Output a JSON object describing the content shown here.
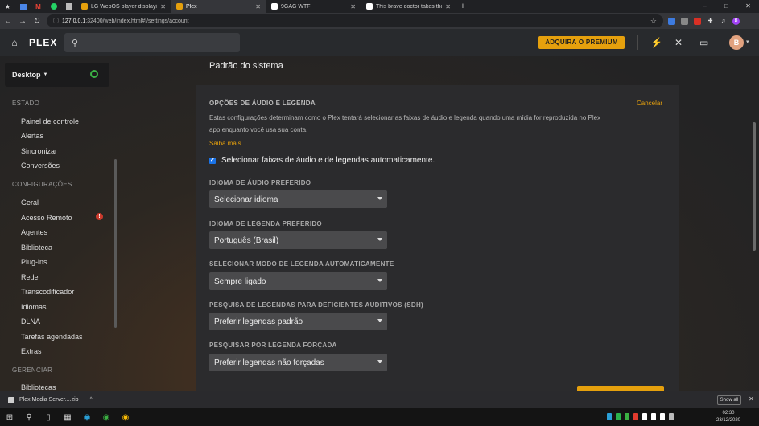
{
  "browser": {
    "tabs": [
      {
        "label": "LG WebOS player displaying Port",
        "favicon_color": "#e5a00d"
      },
      {
        "label": "Plex",
        "favicon_color": "#e5a00d",
        "active": true
      },
      {
        "label": "9GAG WTF",
        "favicon_color": "#ffffff"
      },
      {
        "label": "This brave doctor takes the Covi",
        "favicon_color": "#ffffff"
      }
    ],
    "new_tab": "+",
    "window_controls": {
      "minimize": "–",
      "maximize": "□",
      "close": "✕"
    },
    "url_host": "127.0.0.1",
    "url_rest": ":32400/web/index.html#!/settings/account",
    "profile_initial": "B"
  },
  "header": {
    "logo": "PLEX",
    "premium_label": "ADQUIRA O PREMIUM",
    "avatar_initial": "B"
  },
  "sidebar": {
    "device": "Desktop",
    "sections": [
      {
        "title": "ESTADO",
        "items": [
          "Painel de controle",
          "Alertas",
          "Sincronizar",
          "Conversões"
        ]
      },
      {
        "title": "CONFIGURAÇÕES",
        "items": [
          "Geral",
          "Acesso Remoto",
          "Agentes",
          "Biblioteca",
          "Plug-ins",
          "Rede",
          "Transcodificador",
          "Idiomas",
          "DLNA",
          "Tarefas agendadas",
          "Extras"
        ]
      },
      {
        "title": "GERENCIAR",
        "items": [
          "Bibliotecas"
        ]
      }
    ],
    "warning_badge": "!"
  },
  "main": {
    "page_top": "Padrão do sistema",
    "section_title": "OPÇÕES DE ÁUDIO E LEGENDA",
    "cancel_label": "Cancelar",
    "description_line1": "Estas configurações determinam como o Plex tentará selecionar as faixas de áudio e legenda quando uma mídia for reproduzida no Plex",
    "description_line2": "app enquanto você usa sua conta.",
    "learn_more": "Saiba mais",
    "auto_select_label": "Selecionar faixas de áudio e de legendas automaticamente.",
    "auto_select_checked": true,
    "fields": [
      {
        "label": "IDIOMA DE ÁUDIO PREFERIDO",
        "value": "Selecionar idioma"
      },
      {
        "label": "IDIOMA DE LEGENDA PREFERIDO",
        "value": "Português (Brasil)"
      },
      {
        "label": "SELECIONAR MODO DE LEGENDA AUTOMATICAMENTE",
        "value": "Sempre ligado"
      },
      {
        "label": "PESQUISA DE LEGENDAS PARA DEFICIENTES AUDITIVOS (SDH)",
        "value": "Preferir legendas padrão"
      },
      {
        "label": "PESQUISAR POR LEGENDA FORÇADA",
        "value": "Preferir legendas não forçadas"
      }
    ]
  },
  "downloads": {
    "item": "Plex Media Server....zip",
    "show_all": "Show all"
  },
  "taskbar": {
    "time": "02:30",
    "date": "23/12/2020",
    "tray_colors": [
      "#2a9fd6",
      "#2bb24c",
      "#3bb143",
      "#e33b2e",
      "#ffffff",
      "#ffffff",
      "#ffffff",
      "#bbbbbb"
    ]
  },
  "colors": {
    "accent": "#e5a00d",
    "panel": "#2b2b2d",
    "dropdown": "#4a4a4c"
  }
}
